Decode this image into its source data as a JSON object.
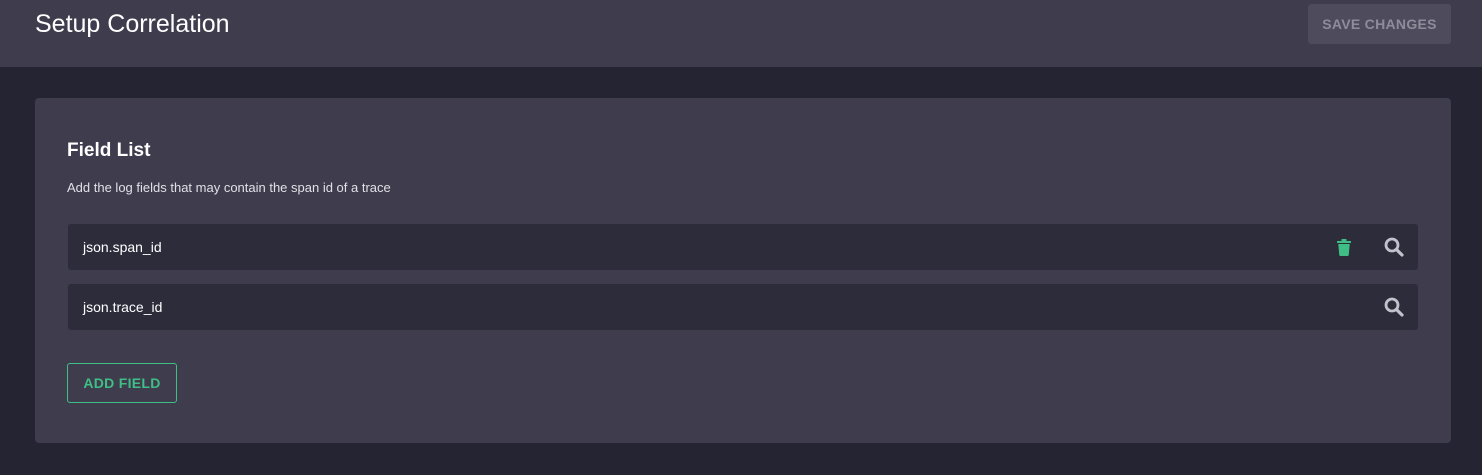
{
  "header": {
    "title": "Setup Correlation",
    "save_label": "SAVE CHANGES"
  },
  "card": {
    "title": "Field List",
    "description": "Add the log fields that may contain the span id of a trace",
    "fields": [
      {
        "name": "json.span_id",
        "icons": [
          "trash-icon",
          "search-icon"
        ]
      },
      {
        "name": "json.trace_id",
        "icons": [
          "search-icon"
        ]
      }
    ],
    "add_label": "ADD FIELD"
  },
  "colors": {
    "accent": "#3fbf85",
    "background": "#252433",
    "panel": "#3e3c4d",
    "row": "#2d2c3b",
    "icon_muted": "#c3c2cc"
  }
}
